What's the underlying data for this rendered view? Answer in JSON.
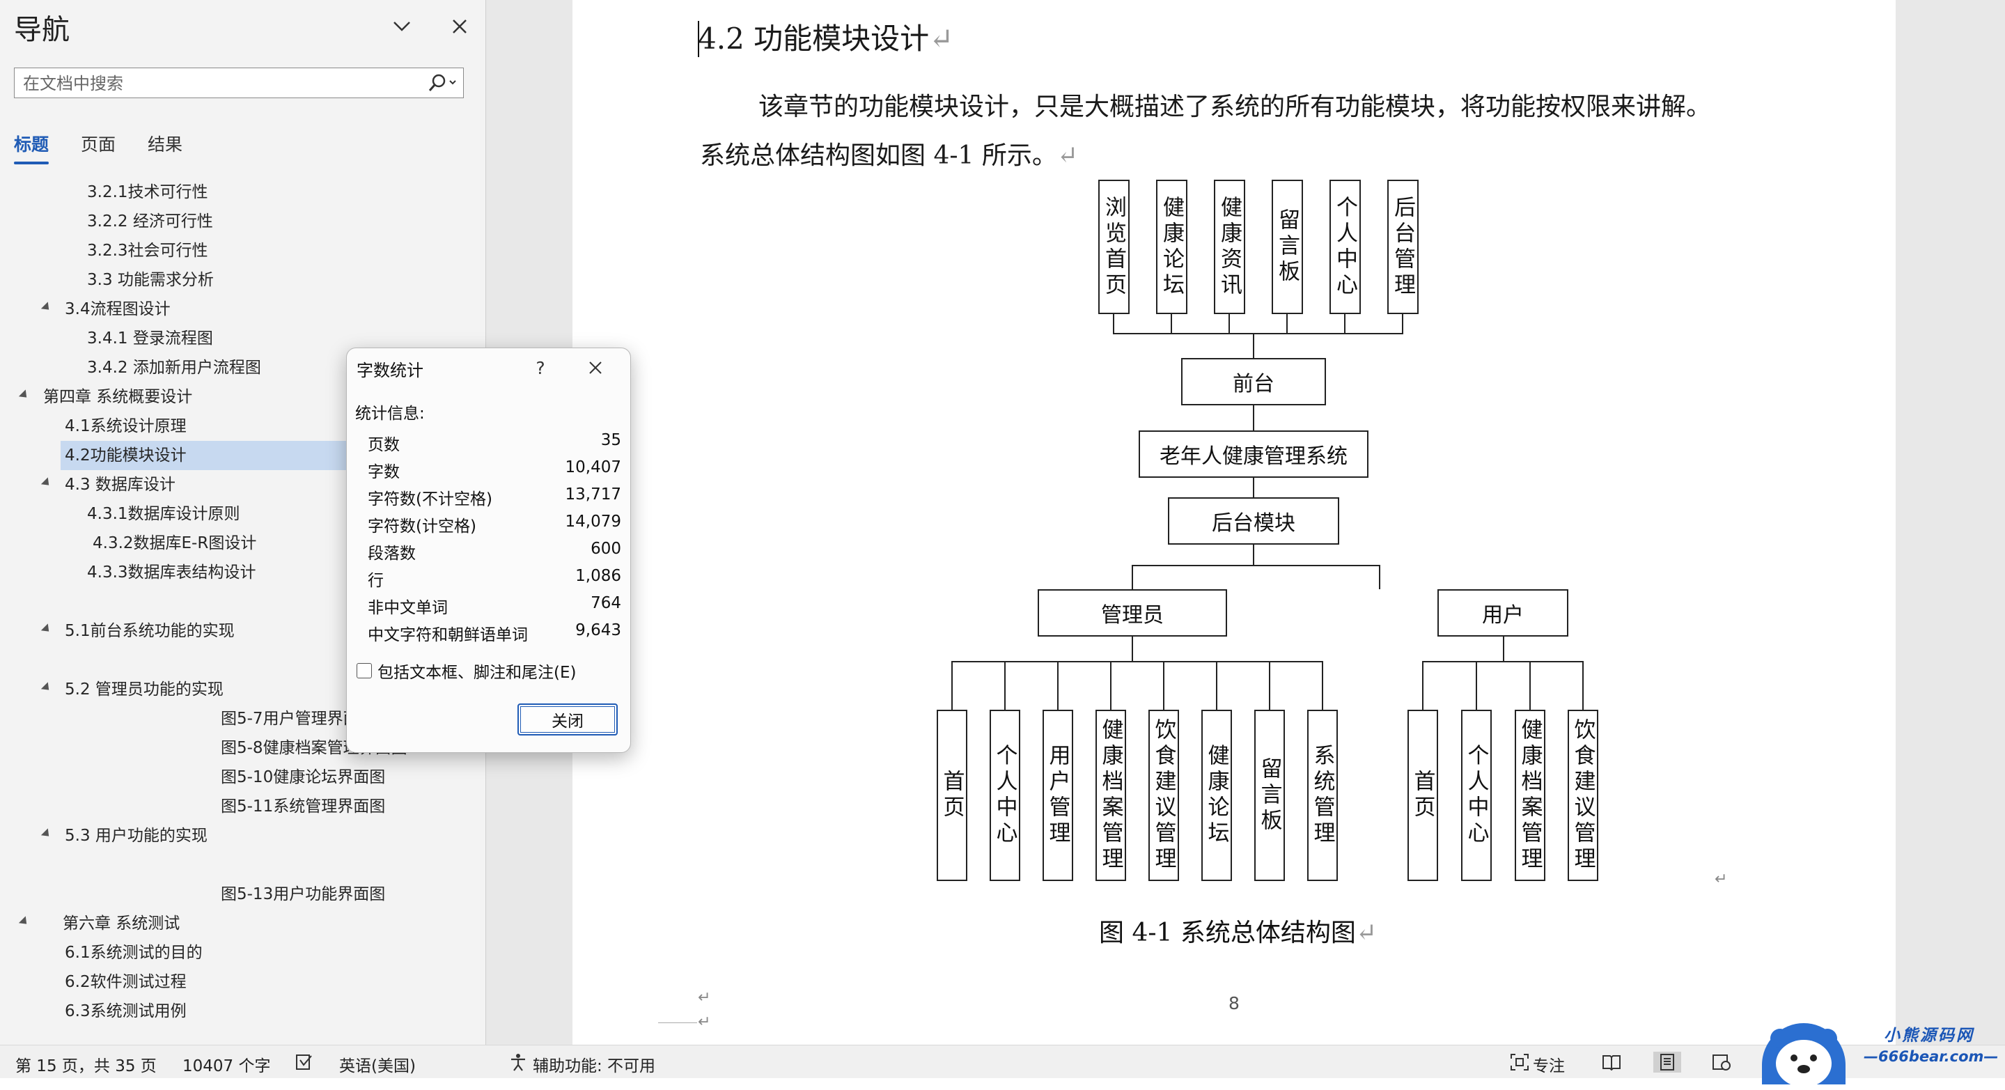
{
  "nav": {
    "title": "导航",
    "search_placeholder": "在文档中搜索",
    "tabs": [
      "标题",
      "页面",
      "结果"
    ],
    "outline": [
      "3.2.1技术可行性",
      "3.2.2 经济可行性",
      "3.2.3社会可行性",
      "3.3 功能需求分析",
      "3.4流程图设计",
      "3.4.1 登录流程图",
      "3.4.2 添加新用户流程图",
      "第四章 系统概要设计",
      "4.1系统设计原理",
      "4.2功能模块设计",
      "4.3 数据库设计",
      "4.3.1数据库设计原则",
      "4.3.2数据库E-R图设计",
      "4.3.3数据库表结构设计",
      "5.1前台系统功能的实现",
      "5.2 管理员功能的实现",
      "图5-7用户管理界面图",
      "图5-8健康档案管理界面图",
      "图5-10健康论坛界面图",
      "图5-11系统管理界面图",
      "5.3 用户功能的实现",
      "图5-13用户功能界面图",
      "第六章 系统测试",
      "6.1系统测试的目的",
      "6.2软件测试过程",
      "6.3系统测试用例"
    ],
    "selected_item": "4.2功能模块设计"
  },
  "document": {
    "heading": "4.2 功能模块设计",
    "para_line1": "该章节的功能模块设计，只是大概描述了系统的所有功能模块，将功能按权限来讲解。",
    "para_line2": "系统总体结构图如图 4-1 所示。",
    "para_mark": "↵",
    "diagram": {
      "top_modules": [
        "浏览首页",
        "健康论坛",
        "健康资讯",
        "留言板",
        "个人中心",
        "后台管理"
      ],
      "front_label": "前台",
      "system_label": "老年人健康管理系统",
      "backend_label": "后台模块",
      "admin_label": "管理员",
      "user_label": "用户",
      "admin_modules": [
        "首页",
        "个人中心",
        "用户管理",
        "健康档案管理",
        "饮食建议管理",
        "健康论坛",
        "留言板",
        "系统管理"
      ],
      "user_modules": [
        "首页",
        "个人中心",
        "健康档案管理",
        "饮食建议管理"
      ]
    },
    "caption": "图 4-1  系统总体结构图",
    "page_number": "8"
  },
  "dialog": {
    "title": "字数统计",
    "help": "?",
    "subtitle": "统计信息:",
    "stats": [
      {
        "label": "页数",
        "value": "35"
      },
      {
        "label": "字数",
        "value": "10,407"
      },
      {
        "label": "字符数(不计空格)",
        "value": "13,717"
      },
      {
        "label": "字符数(计空格)",
        "value": "14,079"
      },
      {
        "label": "段落数",
        "value": "600"
      },
      {
        "label": "行",
        "value": "1,086"
      },
      {
        "label": "非中文单词",
        "value": "764"
      },
      {
        "label": "中文字符和朝鲜语单词",
        "value": "9,643"
      }
    ],
    "checkbox_label": "包括文本框、脚注和尾注(E)",
    "close_button": "关闭"
  },
  "status": {
    "page_info": "第 15 页，共 35 页",
    "word_count": "10407 个字",
    "language": "英语(美国)",
    "accessibility": "辅助功能: 不可用",
    "focus": "专注"
  },
  "watermark": {
    "line1": "小熊源码网",
    "line2": "—666bear.com—"
  }
}
